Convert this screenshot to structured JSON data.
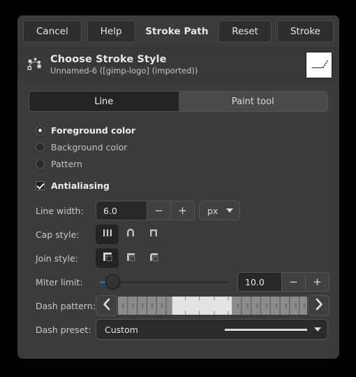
{
  "window": {
    "titlebar": {
      "cancel_label": "Cancel",
      "help_label": "Help",
      "title": "Stroke Path",
      "reset_label": "Reset",
      "stroke_label": "Stroke"
    },
    "header": {
      "title": "Choose Stroke Style",
      "subtitle": "Unnamed-6 ([gimp-logo] (imported))",
      "icon": "path-tool-icon",
      "thumbnail": "path-preview-thumbnail"
    }
  },
  "tabs": [
    {
      "label": "Line",
      "active": true
    },
    {
      "label": "Paint tool",
      "active": false
    }
  ],
  "stroke_source": {
    "options": [
      {
        "label": "Foreground color",
        "selected": true
      },
      {
        "label": "Background color",
        "selected": false
      },
      {
        "label": "Pattern",
        "selected": false
      }
    ]
  },
  "antialiasing": {
    "label": "Antialiasing",
    "checked": true
  },
  "line_width": {
    "label": "Line width:",
    "value": "6.0",
    "minus_label": "−",
    "plus_label": "+",
    "unit": "px"
  },
  "cap_style": {
    "label": "Cap style:",
    "options": [
      {
        "name": "cap-butt-icon",
        "selected": true
      },
      {
        "name": "cap-round-icon",
        "selected": false
      },
      {
        "name": "cap-square-icon",
        "selected": false
      }
    ]
  },
  "join_style": {
    "label": "Join style:",
    "options": [
      {
        "name": "join-miter-icon",
        "selected": true
      },
      {
        "name": "join-round-icon",
        "selected": false
      },
      {
        "name": "join-bevel-icon",
        "selected": false
      }
    ]
  },
  "miter_limit": {
    "label": "Miter limit:",
    "value": "10.0",
    "slider_percent": 6,
    "minus_label": "−",
    "plus_label": "+"
  },
  "dash_pattern": {
    "label": "Dash pattern:",
    "prev_icon": "chevron-left-icon",
    "next_icon": "chevron-right-icon"
  },
  "dash_preset": {
    "label": "Dash preset:",
    "value": "Custom"
  },
  "colors": {
    "dialog_bg": "#3b3b3b",
    "header_bg": "#383838",
    "entry_bg": "#282828",
    "accent": "#2f6bb5",
    "text": "#e8e8e8",
    "muted_text": "#c3c3c3"
  }
}
